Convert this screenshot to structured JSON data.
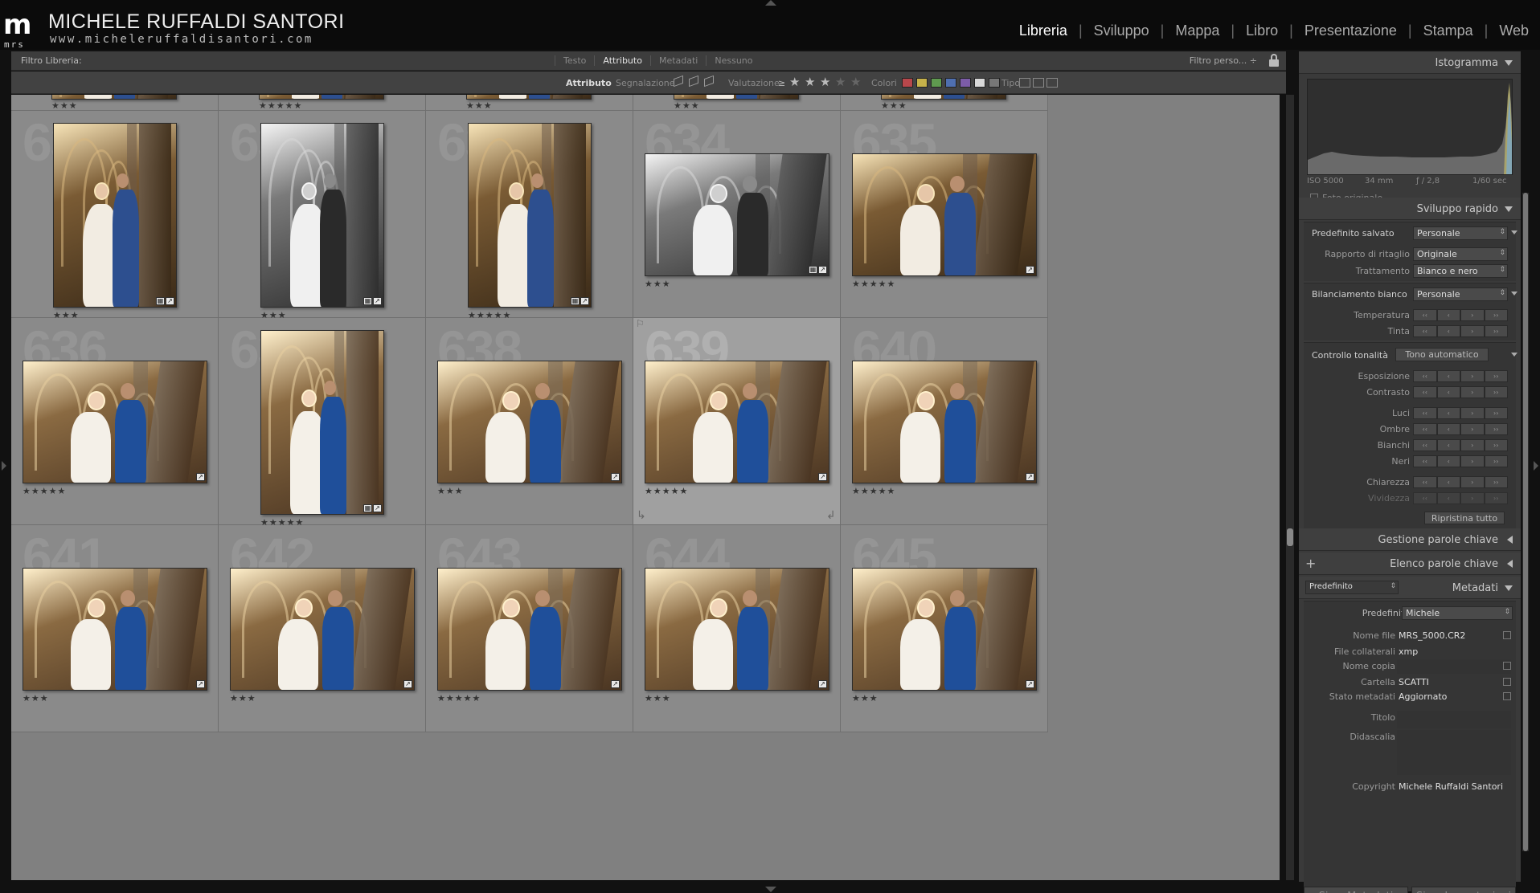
{
  "brand": {
    "mark": "m",
    "mark_sub": "mrs",
    "name": "MICHELE RUFFALDI SANTORI",
    "url": "www.micheleruffaldisantori.com"
  },
  "modules": [
    {
      "label": "Libreria",
      "active": true
    },
    {
      "label": "Sviluppo",
      "active": false
    },
    {
      "label": "Mappa",
      "active": false
    },
    {
      "label": "Libro",
      "active": false
    },
    {
      "label": "Presentazione",
      "active": false
    },
    {
      "label": "Stampa",
      "active": false
    },
    {
      "label": "Web",
      "active": false
    }
  ],
  "filter_bar": {
    "label": "Filtro Libreria:",
    "tabs": [
      "Testo",
      "Attributo",
      "Metadati",
      "Nessuno"
    ],
    "active_tab": "Attributo",
    "preset": "Filtro perso... ÷"
  },
  "attribute_bar": {
    "title": "Attributo",
    "flag_label": "Segnalazione",
    "rating_label": "Valutazione",
    "rating_op": "≥",
    "rating_value": 3,
    "colors_label": "Colori",
    "color_swatches": [
      "#b8474b",
      "#c7b24a",
      "#5f9a4f",
      "#4f6fb0",
      "#7c5ca8",
      "#d8d8d8",
      "#777777"
    ],
    "type_label": "Tipo"
  },
  "grid": {
    "top_row_stars": [
      "★★★",
      "★★★★★",
      "★★★",
      "★★★",
      "★★★"
    ],
    "cells": [
      {
        "index": "631",
        "orientation": "port",
        "tone": "warm",
        "stars": "★★★",
        "badges": [
          "grid",
          "edit"
        ]
      },
      {
        "index": "632",
        "orientation": "port",
        "tone": "bw",
        "stars": "★★★",
        "badges": [
          "grid",
          "edit"
        ]
      },
      {
        "index": "633",
        "orientation": "port",
        "tone": "warm",
        "stars": "★★★★★",
        "badges": [
          "grid",
          "edit"
        ]
      },
      {
        "index": "634",
        "orientation": "land",
        "tone": "bw",
        "stars": "★★★",
        "badges": [
          "grid",
          "edit"
        ]
      },
      {
        "index": "635",
        "orientation": "land",
        "tone": "warm",
        "stars": "★★★★★",
        "badges": [
          "edit"
        ]
      },
      {
        "index": "636",
        "orientation": "land",
        "tone": "cool",
        "stars": "★★★★★",
        "badges": [
          "edit"
        ]
      },
      {
        "index": "637",
        "orientation": "port",
        "tone": "cool",
        "stars": "★★★★★",
        "badges": [
          "grid",
          "edit"
        ]
      },
      {
        "index": "638",
        "orientation": "land",
        "tone": "cool",
        "stars": "★★★",
        "badges": [
          "edit"
        ]
      },
      {
        "index": "639",
        "orientation": "land",
        "tone": "cool",
        "stars": "★★★★★",
        "badges": [
          "edit"
        ],
        "selected": true
      },
      {
        "index": "640",
        "orientation": "land",
        "tone": "cool",
        "stars": "★★★★★",
        "badges": [
          "edit"
        ]
      },
      {
        "index": "641",
        "orientation": "land",
        "tone": "cool",
        "stars": "★★★",
        "badges": [
          "edit"
        ]
      },
      {
        "index": "642",
        "orientation": "land",
        "tone": "cool",
        "stars": "★★★",
        "badges": [
          "edit"
        ]
      },
      {
        "index": "643",
        "orientation": "land",
        "tone": "cool",
        "stars": "★★★★★",
        "badges": [
          "edit"
        ]
      },
      {
        "index": "644",
        "orientation": "land",
        "tone": "cool",
        "stars": "★★★",
        "badges": [
          "edit"
        ]
      },
      {
        "index": "645",
        "orientation": "land",
        "tone": "cool",
        "stars": "★★★",
        "badges": [
          "edit"
        ]
      }
    ]
  },
  "right_panel": {
    "histogram": {
      "title": "Istogramma",
      "iso": "ISO 5000",
      "focal": "34 mm",
      "aperture": "ƒ / 2,8",
      "shutter": "1/60 sec",
      "original_photo": "Foto originale"
    },
    "quick_develop": {
      "title": "Sviluppo rapido",
      "saved_preset_label": "Predefinito salvato",
      "saved_preset_value": "Personale",
      "crop_label": "Rapporto di ritaglio",
      "crop_value": "Originale",
      "treatment_label": "Trattamento",
      "treatment_value": "Bianco e nero",
      "wb_label": "Bilanciamento bianco",
      "wb_value": "Personale",
      "temperature_label": "Temperatura",
      "tint_label": "Tinta",
      "tone_label": "Controllo tonalità",
      "auto_tone": "Tono automatico",
      "exposure_label": "Esposizione",
      "contrast_label": "Contrasto",
      "highlights_label": "Luci",
      "shadows_label": "Ombre",
      "whites_label": "Bianchi",
      "blacks_label": "Neri",
      "clarity_label": "Chiarezza",
      "vibrance_label": "Vividezza",
      "reset_all": "Ripristina tutto"
    },
    "keywording": {
      "title": "Gestione parole chiave"
    },
    "keyword_list": {
      "title": "Elenco parole chiave",
      "add": "+"
    },
    "metadata": {
      "title": "Metadati",
      "preset_selector": "Predefinito",
      "preset_label": "Predefinito",
      "preset_value": "Michele",
      "filename_label": "Nome file",
      "filename_value": "MRS_5000.CR2",
      "sidecar_label": "File collaterali",
      "sidecar_value": "xmp",
      "copy_name_label": "Nome copia",
      "folder_label": "Cartella",
      "folder_value": "SCATTI",
      "status_label": "Stato metadati",
      "status_value": "Aggiornato",
      "title_label": "Titolo",
      "caption_label": "Didascalia",
      "copyright_label": "Copyright",
      "copyright_value": "Michele Ruffaldi Santori"
    },
    "buttons": {
      "sync_metadata": "Sinc. Metadati",
      "sync_settings": "Sinc. Impostazioni"
    }
  }
}
